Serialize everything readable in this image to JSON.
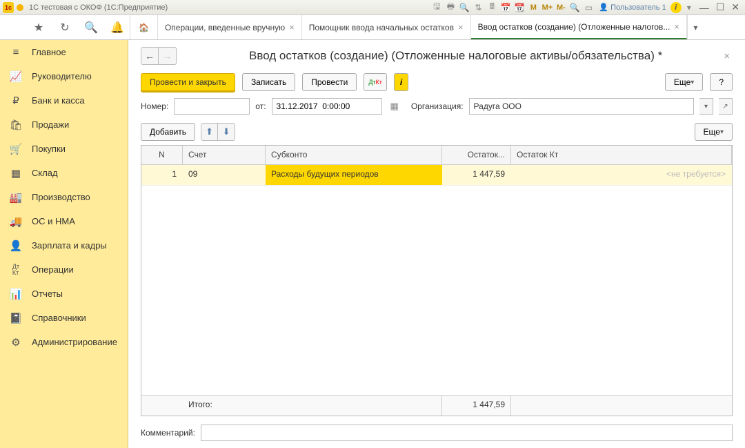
{
  "titlebar": {
    "title": "1С тестовая с ОКОФ  (1С:Предприятие)",
    "user": "Пользователь 1"
  },
  "tabs": {
    "t1": "Операции, введенные вручную",
    "t2": "Помощник ввода начальных остатков",
    "t3": "Ввод остатков (создание) (Отложенные налогов..."
  },
  "sidebar": {
    "items": [
      {
        "label": "Главное"
      },
      {
        "label": "Руководителю"
      },
      {
        "label": "Банк и касса"
      },
      {
        "label": "Продажи"
      },
      {
        "label": "Покупки"
      },
      {
        "label": "Склад"
      },
      {
        "label": "Производство"
      },
      {
        "label": "ОС и НМА"
      },
      {
        "label": "Зарплата и кадры"
      },
      {
        "label": "Операции"
      },
      {
        "label": "Отчеты"
      },
      {
        "label": "Справочники"
      },
      {
        "label": "Администрирование"
      }
    ]
  },
  "page": {
    "title": "Ввод остатков (создание) (Отложенные налоговые активы/обязательства) *"
  },
  "toolbar": {
    "post_close": "Провести и закрыть",
    "save": "Записать",
    "post": "Провести",
    "more": "Еще",
    "help": "?"
  },
  "form": {
    "number_label": "Номер:",
    "number_value": "",
    "from_label": "от:",
    "date_value": "31.12.2017  0:00:00",
    "org_label": "Организация:",
    "org_value": "Радуга ООО"
  },
  "table_toolbar": {
    "add": "Добавить",
    "more": "Еще"
  },
  "table": {
    "headers": {
      "n": "N",
      "acc": "Счет",
      "sub": "Субконто",
      "dt": "Остаток...",
      "kt": "Остаток Кт"
    },
    "rows": [
      {
        "n": "1",
        "acc": "09",
        "sub": "Расходы будущих периодов",
        "dt": "1 447,59",
        "kt": "<не требуется>"
      }
    ],
    "footer": {
      "label": "Итого:",
      "dt": "1 447,59"
    }
  },
  "comment": {
    "label": "Комментарий:",
    "value": ""
  }
}
